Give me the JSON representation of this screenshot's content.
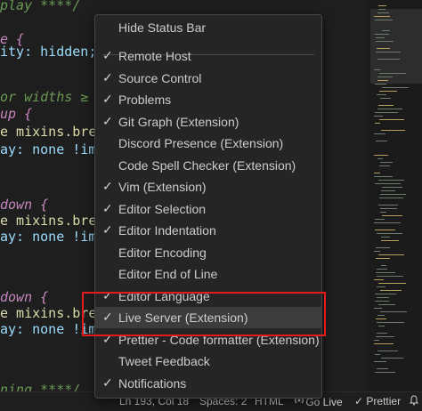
{
  "editor": {
    "lines": [
      {
        "text": "play ****/",
        "cls": "c-comment"
      },
      {
        "text": "e {",
        "cls": "c-key"
      },
      {
        "text": "ity: hidden;",
        "cls": "c-prop"
      },
      {
        "text": "or widths ≥ l",
        "cls": "c-comment"
      },
      {
        "text": "up {",
        "cls": "c-key"
      },
      {
        "text": "e mixins.break",
        "cls": "c-fn"
      },
      {
        "text": "ay: none !impo",
        "cls": "c-prop"
      },
      {
        "text": "down {",
        "cls": "c-key"
      },
      {
        "text": "e mixins.break",
        "cls": "c-fn"
      },
      {
        "text": "ay: none !impo",
        "cls": "c-prop"
      },
      {
        "text": "down {",
        "cls": "c-key"
      },
      {
        "text": "e mixins.break",
        "cls": "c-fn"
      },
      {
        "text": "ay: none !impo",
        "cls": "c-prop"
      },
      {
        "text": "ning ****/",
        "cls": "c-comment"
      }
    ]
  },
  "menu": {
    "header": "Hide Status Bar",
    "items": [
      {
        "label": "Remote Host",
        "checked": true
      },
      {
        "label": "Source Control",
        "checked": true
      },
      {
        "label": "Problems",
        "checked": true
      },
      {
        "label": "Git Graph (Extension)",
        "checked": true
      },
      {
        "label": "Discord Presence (Extension)",
        "checked": false
      },
      {
        "label": "Code Spell Checker (Extension)",
        "checked": false
      },
      {
        "label": "Vim (Extension)",
        "checked": true
      },
      {
        "label": "Editor Selection",
        "checked": true
      },
      {
        "label": "Editor Indentation",
        "checked": true
      },
      {
        "label": "Editor Encoding",
        "checked": false
      },
      {
        "label": "Editor End of Line",
        "checked": false
      },
      {
        "label": "Editor Language",
        "checked": true
      },
      {
        "label": "Live Server (Extension)",
        "checked": true,
        "active": true
      },
      {
        "label": "Prettier - Code formatter (Extension)",
        "checked": true
      },
      {
        "label": "Tweet Feedback",
        "checked": false
      },
      {
        "label": "Notifications",
        "checked": true
      }
    ]
  },
  "statusbar": {
    "position": "Ln 193, Col 18",
    "spaces": "Spaces: 2",
    "language": "HTML",
    "golive": "Go Live",
    "prettier": "Prettier",
    "golive_icon": "broadcast-icon",
    "prettier_icon": "double-check-icon",
    "bell_icon": "bell-icon"
  },
  "colors": {
    "accent_highlight": "#e31b1b",
    "menu_bg": "#252526",
    "active_item_bg": "#3c3c3c"
  }
}
